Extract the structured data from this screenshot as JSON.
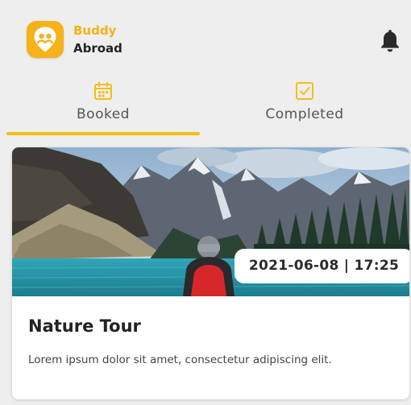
{
  "header": {
    "logo_line1": "Buddy",
    "logo_line2": "Abroad",
    "logo_icon": "buddy-abroad-logo-icon",
    "notification_icon": "bell-icon"
  },
  "tabs": [
    {
      "label": "Booked",
      "icon": "calendar-icon",
      "active": true
    },
    {
      "label": "Completed",
      "icon": "checkbox-icon",
      "active": false
    }
  ],
  "booking": {
    "image": "mountain-lake-hiker-photo",
    "datetime": "2021-06-08 | 17:25",
    "title": "Nature Tour",
    "description": "Lorem ipsum dolor sit amet, consectetur adipiscing elit."
  },
  "colors": {
    "accent": "#f5bd18",
    "brand_dark": "#232323",
    "background": "#eeeeee"
  }
}
